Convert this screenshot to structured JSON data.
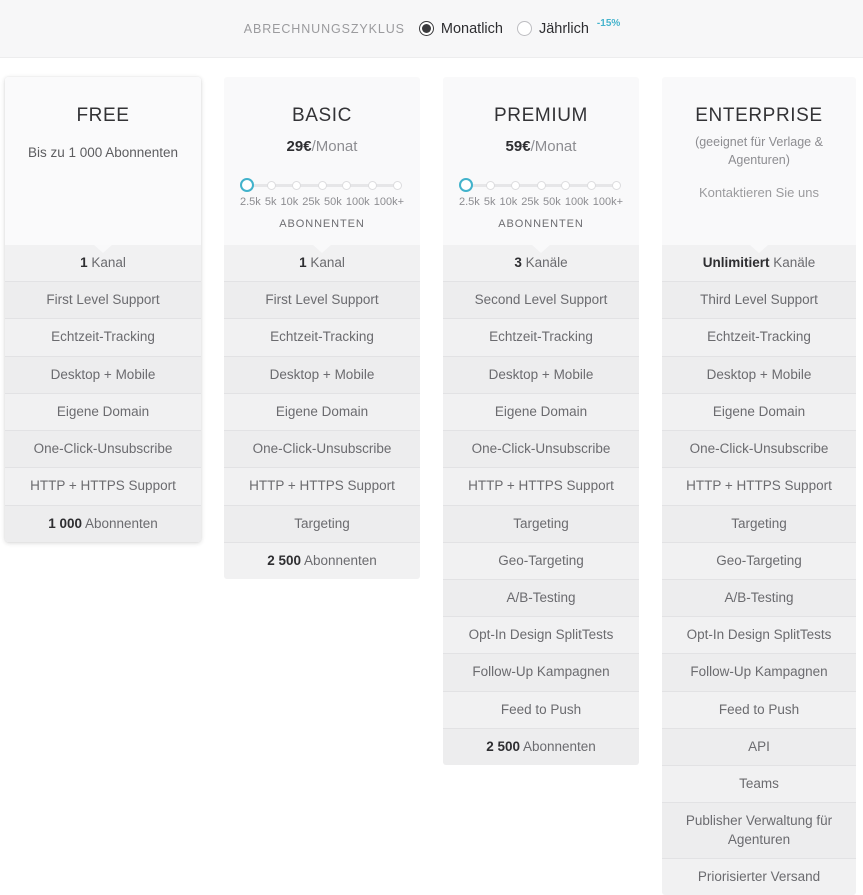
{
  "billing": {
    "label": "ABRECHNUNGSZYKLUS",
    "monthly_label": "Monatlich",
    "yearly_label": "Jährlich",
    "discount_badge": "-15%",
    "selected": "Monatlich",
    "accent_color": "#46b4cd"
  },
  "slider": {
    "ticks": [
      "2.5k",
      "5k",
      "10k",
      "25k",
      "50k",
      "100k",
      "100k+"
    ],
    "caption": "ABONNENTEN",
    "selected_index": 0,
    "handle_color": "#41b2cb"
  },
  "plans": [
    {
      "name": "FREE",
      "note": "Bis zu 1 000 Abonnenten",
      "has_slider": false,
      "featured": true,
      "features": [
        {
          "strong": "1",
          "text": "Kanal"
        },
        {
          "strong": "",
          "text": "First Level Support"
        },
        {
          "strong": "",
          "text": "Echtzeit-Tracking"
        },
        {
          "strong": "",
          "text": "Desktop + Mobile"
        },
        {
          "strong": "",
          "text": "Eigene Domain"
        },
        {
          "strong": "",
          "text": "One-Click-Unsubscribe"
        },
        {
          "strong": "",
          "text": "HTTP + HTTPS Support"
        },
        {
          "strong": "1 000",
          "text": "Abonnenten"
        }
      ]
    },
    {
      "name": "BASIC",
      "price_amount": "29€",
      "price_period": "/Monat",
      "has_slider": true,
      "featured": false,
      "features": [
        {
          "strong": "1",
          "text": "Kanal"
        },
        {
          "strong": "",
          "text": "First Level Support"
        },
        {
          "strong": "",
          "text": "Echtzeit-Tracking"
        },
        {
          "strong": "",
          "text": "Desktop + Mobile"
        },
        {
          "strong": "",
          "text": "Eigene Domain"
        },
        {
          "strong": "",
          "text": "One-Click-Unsubscribe"
        },
        {
          "strong": "",
          "text": "HTTP + HTTPS Support"
        },
        {
          "strong": "",
          "text": "Targeting"
        },
        {
          "strong": "2 500",
          "text": "Abonnenten"
        }
      ]
    },
    {
      "name": "PREMIUM",
      "price_amount": "59€",
      "price_period": "/Monat",
      "has_slider": true,
      "featured": false,
      "features": [
        {
          "strong": "3",
          "text": "Kanäle"
        },
        {
          "strong": "",
          "text": "Second Level Support"
        },
        {
          "strong": "",
          "text": "Echtzeit-Tracking"
        },
        {
          "strong": "",
          "text": "Desktop + Mobile"
        },
        {
          "strong": "",
          "text": "Eigene Domain"
        },
        {
          "strong": "",
          "text": "One-Click-Unsubscribe"
        },
        {
          "strong": "",
          "text": "HTTP + HTTPS Support"
        },
        {
          "strong": "",
          "text": "Targeting"
        },
        {
          "strong": "",
          "text": "Geo-Targeting"
        },
        {
          "strong": "",
          "text": "A/B-Testing"
        },
        {
          "strong": "",
          "text": "Opt-In Design SplitTests"
        },
        {
          "strong": "",
          "text": "Follow-Up Kampagnen"
        },
        {
          "strong": "",
          "text": "Feed to Push"
        },
        {
          "strong": "2 500",
          "text": "Abonnenten"
        }
      ]
    },
    {
      "name": "ENTERPRISE",
      "subtitle": "(geeignet für Verlage & Agenturen)",
      "contact": "Kontaktieren Sie uns",
      "has_slider": false,
      "featured": false,
      "features": [
        {
          "strong": "Unlimitiert",
          "text": "Kanäle"
        },
        {
          "strong": "",
          "text": "Third Level Support"
        },
        {
          "strong": "",
          "text": "Echtzeit-Tracking"
        },
        {
          "strong": "",
          "text": "Desktop + Mobile"
        },
        {
          "strong": "",
          "text": "Eigene Domain"
        },
        {
          "strong": "",
          "text": "One-Click-Unsubscribe"
        },
        {
          "strong": "",
          "text": "HTTP + HTTPS Support"
        },
        {
          "strong": "",
          "text": "Targeting"
        },
        {
          "strong": "",
          "text": "Geo-Targeting"
        },
        {
          "strong": "",
          "text": "A/B-Testing"
        },
        {
          "strong": "",
          "text": "Opt-In Design SplitTests"
        },
        {
          "strong": "",
          "text": "Follow-Up Kampagnen"
        },
        {
          "strong": "",
          "text": "Feed to Push"
        },
        {
          "strong": "",
          "text": "API"
        },
        {
          "strong": "",
          "text": "Teams"
        },
        {
          "strong": "",
          "text": "Publisher Verwaltung für Agenturen"
        },
        {
          "strong": "",
          "text": "Priorisierter Versand"
        }
      ]
    }
  ]
}
